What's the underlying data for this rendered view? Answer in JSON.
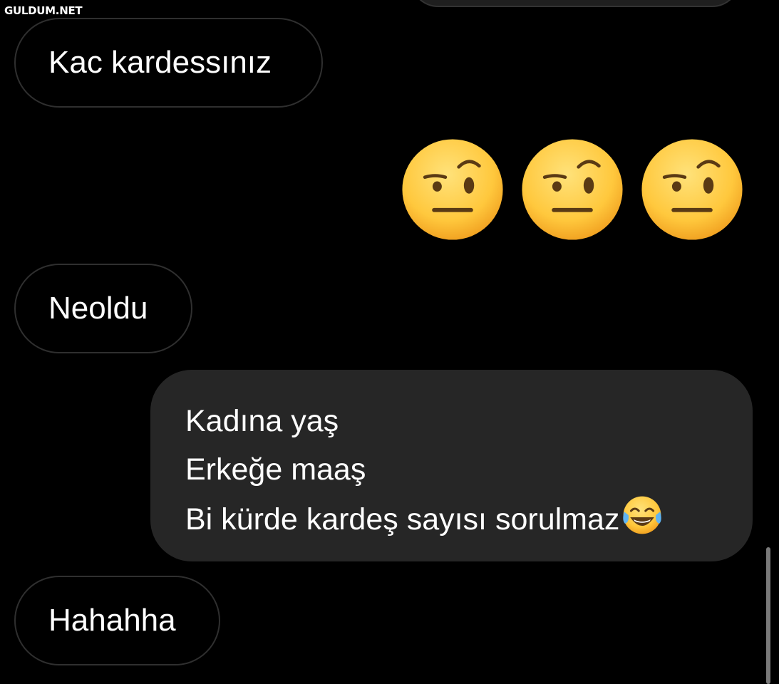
{
  "watermark": "GULDUM.NET",
  "messages": [
    {
      "side": "received",
      "text": "Kac kardessınız"
    },
    {
      "side": "sent",
      "emoji": [
        "face-with-raised-eyebrow",
        "face-with-raised-eyebrow",
        "face-with-raised-eyebrow"
      ]
    },
    {
      "side": "received",
      "text": "Neoldu"
    },
    {
      "side": "sent",
      "lines": [
        "Kadına yaş",
        "Erkeğe maaş",
        "Bi kürde kardeş sayısı sorulmaz"
      ],
      "trailing_emoji": "face-with-tears-of-joy"
    },
    {
      "side": "received",
      "text": "Hahahha"
    }
  ],
  "colors": {
    "background": "#000000",
    "received_bubble_border": "#2f2f2f",
    "sent_bubble_bg": "#262626",
    "text": "#ffffff",
    "emoji_yellow": "#FFC83D"
  }
}
